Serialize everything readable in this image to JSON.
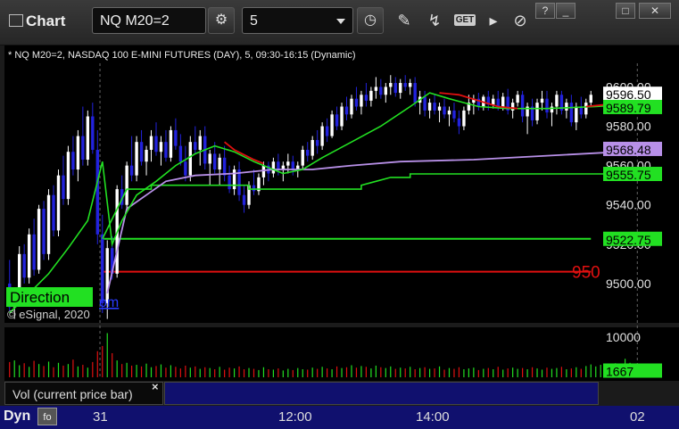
{
  "toolbar": {
    "title": "Chart",
    "symbol": "NQ M20=2",
    "interval": "5",
    "get_label": "GET"
  },
  "window_buttons": [
    "?",
    "_",
    "□",
    "✕"
  ],
  "chart_header": "* NQ M20=2, NASDAQ 100 E-MINI FUTURES (DAY), 5, 09:30-16:15 (Dynamic)",
  "watermark": "© eSignal, 2020",
  "direction_label": "Direction",
  "link_fragment": "om",
  "colors": {
    "bg": "#000000",
    "up_candle": "#ffffff",
    "down_candle": "#2222dd",
    "green": "#22e022",
    "red": "#e01010",
    "purple": "#b890e8",
    "volume_panel": "#10106e"
  },
  "chart_data": {
    "type": "candlestick",
    "ylim": [
      9480,
      9612
    ],
    "yticks": [
      9500,
      9520,
      9540,
      9560,
      9580,
      9600
    ],
    "ytick_labels": [
      "9500.00",
      "9520.00",
      "9540.00",
      "9560.00",
      "9580.00",
      "9600.00"
    ],
    "xticks": [
      {
        "label": "31",
        "bar": 19
      },
      {
        "label": "12:00",
        "bar": 59
      },
      {
        "label": "14:00",
        "bar": 87
      },
      {
        "label": "02",
        "bar": 129
      }
    ],
    "price_labels": [
      {
        "value": "9596.50",
        "price": 9596.5,
        "bg": "#ffffff",
        "fg": "#000000"
      },
      {
        "value": "9589.79",
        "price": 9589.79,
        "bg": "#22e022",
        "fg": "#000000"
      },
      {
        "value": "9568.48",
        "price": 9568.48,
        "bg": "#b890e8",
        "fg": "#000000"
      },
      {
        "value": "9555.75",
        "price": 9555.75,
        "bg": "#22e022",
        "fg": "#000000"
      },
      {
        "value": "9522.75",
        "price": 9522.75,
        "bg": "#22e022",
        "fg": "#000000"
      }
    ],
    "red_level": {
      "price": 9506,
      "label": "950"
    },
    "green_level": {
      "price": 9522.75
    },
    "step_line": [
      [
        19,
        9522.75
      ],
      [
        24,
        9548
      ],
      [
        29,
        9548
      ],
      [
        29,
        9550
      ],
      [
        49,
        9550
      ],
      [
        49,
        9548
      ],
      [
        72,
        9548
      ],
      [
        72,
        9550
      ],
      [
        75,
        9552
      ],
      [
        78,
        9554
      ],
      [
        82,
        9554
      ],
      [
        82,
        9555.75
      ],
      [
        130,
        9555.75
      ]
    ],
    "vwap_points": [
      [
        20,
        9495
      ],
      [
        24,
        9538
      ],
      [
        28,
        9545
      ],
      [
        32,
        9552
      ],
      [
        38,
        9555
      ],
      [
        46,
        9556
      ],
      [
        54,
        9558
      ],
      [
        62,
        9558
      ],
      [
        70,
        9560
      ],
      [
        80,
        9562
      ],
      [
        95,
        9563
      ],
      [
        110,
        9565
      ],
      [
        125,
        9567
      ],
      [
        130,
        9568.48
      ]
    ],
    "ma_points": [
      [
        0,
        9485
      ],
      [
        4,
        9495
      ],
      [
        8,
        9505
      ],
      [
        12,
        9518
      ],
      [
        16,
        9532
      ],
      [
        19,
        9562
      ],
      [
        21,
        9520
      ],
      [
        23,
        9532
      ],
      [
        26,
        9545
      ],
      [
        30,
        9552
      ],
      [
        34,
        9560
      ],
      [
        38,
        9566
      ],
      [
        42,
        9570
      ],
      [
        46,
        9567
      ],
      [
        50,
        9562
      ],
      [
        52,
        9560
      ],
      [
        56,
        9556
      ],
      [
        60,
        9558
      ],
      [
        64,
        9564
      ],
      [
        70,
        9572
      ],
      [
        76,
        9580
      ],
      [
        82,
        9590
      ],
      [
        86,
        9597
      ],
      [
        90,
        9594
      ],
      [
        96,
        9590
      ],
      [
        102,
        9589
      ],
      [
        110,
        9589
      ],
      [
        120,
        9590
      ],
      [
        126,
        9591
      ],
      [
        130,
        9589.79
      ]
    ],
    "ma_red_segments": [
      [
        [
          44,
          9572
        ],
        [
          46,
          9568
        ],
        [
          50,
          9563
        ],
        [
          52,
          9561
        ]
      ],
      [
        [
          88,
          9597
        ],
        [
          92,
          9596
        ],
        [
          96,
          9593
        ],
        [
          100,
          9590
        ],
        [
          104,
          9589
        ]
      ],
      [
        [
          118,
          9590
        ],
        [
          122,
          9591
        ]
      ]
    ],
    "candles": [
      [
        9500,
        9512,
        9486,
        9488
      ],
      [
        9488,
        9498,
        9482,
        9495
      ],
      [
        9495,
        9519,
        9493,
        9515
      ],
      [
        9515,
        9520,
        9500,
        9503
      ],
      [
        9503,
        9528,
        9500,
        9525
      ],
      [
        9525,
        9533,
        9504,
        9507
      ],
      [
        9507,
        9540,
        9505,
        9538
      ],
      [
        9538,
        9542,
        9512,
        9515
      ],
      [
        9515,
        9548,
        9512,
        9545
      ],
      [
        9545,
        9550,
        9524,
        9527
      ],
      [
        9527,
        9558,
        9524,
        9555
      ],
      [
        9555,
        9565,
        9540,
        9543
      ],
      [
        9543,
        9570,
        9540,
        9567
      ],
      [
        9567,
        9575,
        9555,
        9558
      ],
      [
        9558,
        9578,
        9552,
        9575
      ],
      [
        9575,
        9590,
        9560,
        9563
      ],
      [
        9563,
        9588,
        9560,
        9585
      ],
      [
        9585,
        9592,
        9566,
        9568
      ],
      [
        9568,
        9578,
        9520,
        9525
      ],
      [
        9525,
        9535,
        9485,
        9490
      ],
      [
        9490,
        9522,
        9482,
        9518
      ],
      [
        9518,
        9524,
        9502,
        9505
      ],
      [
        9505,
        9550,
        9503,
        9548
      ],
      [
        9548,
        9555,
        9538,
        9540
      ],
      [
        9540,
        9562,
        9538,
        9560
      ],
      [
        9560,
        9575,
        9552,
        9555
      ],
      [
        9555,
        9575,
        9552,
        9572
      ],
      [
        9572,
        9578,
        9560,
        9562
      ],
      [
        9562,
        9570,
        9555,
        9568
      ],
      [
        9568,
        9578,
        9562,
        9575
      ],
      [
        9575,
        9582,
        9565,
        9567
      ],
      [
        9567,
        9575,
        9560,
        9572
      ],
      [
        9572,
        9578,
        9562,
        9564
      ],
      [
        9564,
        9580,
        9562,
        9578
      ],
      [
        9578,
        9584,
        9568,
        9570
      ],
      [
        9570,
        9576,
        9560,
        9562
      ],
      [
        9562,
        9570,
        9552,
        9555
      ],
      [
        9555,
        9575,
        9552,
        9572
      ],
      [
        9572,
        9580,
        9566,
        9568
      ],
      [
        9568,
        9578,
        9560,
        9575
      ],
      [
        9575,
        9580,
        9558,
        9561
      ],
      [
        9561,
        9568,
        9550,
        9566
      ],
      [
        9566,
        9572,
        9556,
        9558
      ],
      [
        9558,
        9566,
        9550,
        9564
      ],
      [
        9564,
        9570,
        9552,
        9555
      ],
      [
        9555,
        9560,
        9546,
        9548
      ],
      [
        9548,
        9560,
        9545,
        9558
      ],
      [
        9558,
        9562,
        9542,
        9545
      ],
      [
        9545,
        9550,
        9536,
        9540
      ],
      [
        9540,
        9552,
        9538,
        9550
      ],
      [
        9550,
        9558,
        9545,
        9547
      ],
      [
        9547,
        9556,
        9545,
        9554
      ],
      [
        9554,
        9562,
        9550,
        9560
      ],
      [
        9560,
        9562,
        9552,
        9556
      ],
      [
        9556,
        9564,
        9554,
        9562
      ],
      [
        9562,
        9566,
        9555,
        9558
      ],
      [
        9558,
        9562,
        9552,
        9560
      ],
      [
        9560,
        9566,
        9556,
        9562
      ],
      [
        9562,
        9565,
        9555,
        9558
      ],
      [
        9558,
        9562,
        9554,
        9560
      ],
      [
        9560,
        9570,
        9558,
        9568
      ],
      [
        9568,
        9572,
        9562,
        9565
      ],
      [
        9565,
        9575,
        9563,
        9573
      ],
      [
        9573,
        9578,
        9566,
        9570
      ],
      [
        9570,
        9582,
        9568,
        9580
      ],
      [
        9580,
        9584,
        9572,
        9575
      ],
      [
        9575,
        9588,
        9574,
        9586
      ],
      [
        9586,
        9590,
        9578,
        9580
      ],
      [
        9580,
        9592,
        9578,
        9590
      ],
      [
        9590,
        9595,
        9583,
        9586
      ],
      [
        9586,
        9596,
        9584,
        9594
      ],
      [
        9594,
        9600,
        9588,
        9590
      ],
      [
        9590,
        9598,
        9586,
        9596
      ],
      [
        9596,
        9602,
        9590,
        9593
      ],
      [
        9593,
        9600,
        9590,
        9598
      ],
      [
        9598,
        9605,
        9594,
        9600
      ],
      [
        9600,
        9604,
        9594,
        9596
      ],
      [
        9596,
        9602,
        9592,
        9600
      ],
      [
        9600,
        9606,
        9596,
        9602
      ],
      [
        9602,
        9605,
        9595,
        9597
      ],
      [
        9597,
        9604,
        9594,
        9602
      ],
      [
        9602,
        9606,
        9598,
        9600
      ],
      [
        9600,
        9604,
        9596,
        9602
      ],
      [
        9602,
        9605,
        9590,
        9592
      ],
      [
        9592,
        9598,
        9586,
        9595
      ],
      [
        9595,
        9598,
        9585,
        9588
      ],
      [
        9588,
        9594,
        9584,
        9592
      ],
      [
        9592,
        9596,
        9586,
        9588
      ],
      [
        9588,
        9592,
        9582,
        9590
      ],
      [
        9590,
        9594,
        9584,
        9586
      ],
      [
        9586,
        9590,
        9580,
        9588
      ],
      [
        9588,
        9592,
        9582,
        9584
      ],
      [
        9584,
        9588,
        9576,
        9580
      ],
      [
        9580,
        9590,
        9578,
        9588
      ],
      [
        9588,
        9596,
        9586,
        9592
      ],
      [
        9592,
        9596,
        9586,
        9594
      ],
      [
        9594,
        9597,
        9588,
        9590
      ],
      [
        9590,
        9596,
        9588,
        9595
      ],
      [
        9595,
        9598,
        9588,
        9591
      ],
      [
        9591,
        9596,
        9589,
        9594
      ],
      [
        9594,
        9598,
        9588,
        9590
      ],
      [
        9590,
        9597,
        9588,
        9595
      ],
      [
        9595,
        9599,
        9586,
        9588
      ],
      [
        9588,
        9594,
        9584,
        9592
      ],
      [
        9592,
        9598,
        9590,
        9596
      ],
      [
        9596,
        9598,
        9582,
        9585
      ],
      [
        9585,
        9592,
        9576,
        9590
      ],
      [
        9590,
        9594,
        9580,
        9583
      ],
      [
        9583,
        9594,
        9581,
        9592
      ],
      [
        9592,
        9598,
        9588,
        9594
      ],
      [
        9594,
        9598,
        9584,
        9587
      ],
      [
        9587,
        9592,
        9580,
        9590
      ],
      [
        9590,
        9598,
        9586,
        9596
      ],
      [
        9596,
        9598,
        9586,
        9588
      ],
      [
        9588,
        9594,
        9584,
        9592
      ],
      [
        9592,
        9596,
        9580,
        9582
      ],
      [
        9582,
        9592,
        9578,
        9590
      ],
      [
        9590,
        9595,
        9584,
        9586
      ],
      [
        9586,
        9594,
        9584,
        9592
      ],
      [
        9592,
        9598,
        9590,
        9596
      ]
    ],
    "volume": {
      "ylim": [
        0,
        12000
      ],
      "ytick_label": "10000",
      "ytick_value": 10000,
      "current": "1667",
      "current_value": 1667,
      "values": [
        3800,
        4200,
        3000,
        3500,
        2600,
        4100,
        3300,
        2800,
        3900,
        2500,
        3600,
        2900,
        3300,
        4400,
        2700,
        3100,
        2400,
        3800,
        6500,
        7800,
        11000,
        6000,
        4200,
        3300,
        3600,
        2900,
        3100,
        2700,
        3400,
        2500,
        2800,
        3200,
        2400,
        3000,
        2600,
        2200,
        2900,
        2400,
        2700,
        2100,
        2500,
        2300,
        2000,
        2600,
        1900,
        2400,
        2200,
        2700,
        2000,
        2300,
        2100,
        1800,
        2500,
        2000,
        1900,
        2200,
        1700,
        2100,
        1800,
        2300,
        2000,
        1900,
        2400,
        2100,
        2600,
        2200,
        2000,
        2700,
        2300,
        2500,
        3000,
        2400,
        2800,
        2600,
        2200,
        2900,
        2500,
        2300,
        2700,
        2100,
        2400,
        2200,
        2600,
        2000,
        2300,
        2500,
        2100,
        2200,
        2700,
        1900,
        2300,
        2100,
        2500,
        2000,
        2200,
        2400,
        1800,
        2100,
        2300,
        2000,
        2600,
        1900,
        2200,
        2400,
        2100,
        2300,
        2000,
        2500,
        2200,
        1900,
        2400,
        2100,
        2300,
        2600,
        2000,
        2200,
        2500,
        2100,
        2800,
        3200,
        2700,
        3100,
        2400,
        2600,
        3500,
        2800,
        4600,
        3600,
        2400,
        2100,
        1667
      ]
    }
  },
  "volume_panel": {
    "label": "Vol (current price bar)",
    "close": "×"
  },
  "bottom": {
    "dyn": "Dyn",
    "dyn_btn": "fo"
  }
}
